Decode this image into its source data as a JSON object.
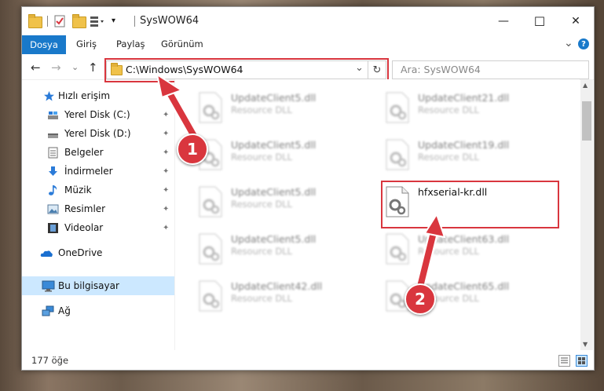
{
  "window": {
    "title": "SysWOW64",
    "minimize": "—",
    "maximize": "☐",
    "close": "✕"
  },
  "ribbon": {
    "file_tab": "Dosya",
    "tabs": [
      "Giriş",
      "Paylaş",
      "Görünüm"
    ],
    "expand": "⌄",
    "help": "?"
  },
  "address": {
    "back": "←",
    "forward": "→",
    "recent": "⌄",
    "up": "↑",
    "path": "C:\\Windows\\SysWOW64",
    "dropdown": "⌄",
    "refresh": "↻",
    "search_placeholder": "Ara: SysWOW64"
  },
  "sidebar": {
    "quick_access": "Hızlı erişim",
    "items": [
      {
        "label": "Yerel Disk (C:)",
        "icon": "drive-icon",
        "pinned": true
      },
      {
        "label": "Yerel Disk (D:)",
        "icon": "drive-icon",
        "pinned": true
      },
      {
        "label": "Belgeler",
        "icon": "document-icon",
        "pinned": true
      },
      {
        "label": "İndirmeler",
        "icon": "download-icon",
        "pinned": true
      },
      {
        "label": "Müzik",
        "icon": "music-icon",
        "pinned": true
      },
      {
        "label": "Resimler",
        "icon": "picture-icon",
        "pinned": true
      },
      {
        "label": "Videolar",
        "icon": "video-icon",
        "pinned": true
      }
    ],
    "onedrive": "OneDrive",
    "this_pc": "Bu bilgisayar",
    "network": "Ağ",
    "pin_glyph": "📌"
  },
  "files": [
    {
      "name": "UpdateClient5.dll",
      "type": "Resource DLL",
      "blurred": true
    },
    {
      "name": "UpdateClient21.dll",
      "type": "Resource DLL",
      "blurred": true
    },
    {
      "name": "UpdateClient5.dll",
      "type": "Resource DLL",
      "blurred": true
    },
    {
      "name": "UpdateClient19.dll",
      "type": "Resource DLL",
      "blurred": true
    },
    {
      "name": "UpdateClient5.dll",
      "type": "Resource DLL",
      "blurred": true
    },
    {
      "name": "hfxserial-kr.dll",
      "type": "",
      "blurred": false
    },
    {
      "name": "UpdateClient5.dll",
      "type": "Resource DLL",
      "blurred": true
    },
    {
      "name": "UpdateClient63.dll",
      "type": "Resource DLL",
      "blurred": true
    },
    {
      "name": "UpdateClient42.dll",
      "type": "Resource DLL",
      "blurred": true
    },
    {
      "name": "UpdateClient65.dll",
      "type": "Resource DLL",
      "blurred": true
    }
  ],
  "status": {
    "count": "177 öğe"
  },
  "callouts": [
    "1",
    "2"
  ],
  "colors": {
    "accent": "#1979ca",
    "highlight": "#d9363e",
    "selected": "#cce8ff"
  }
}
